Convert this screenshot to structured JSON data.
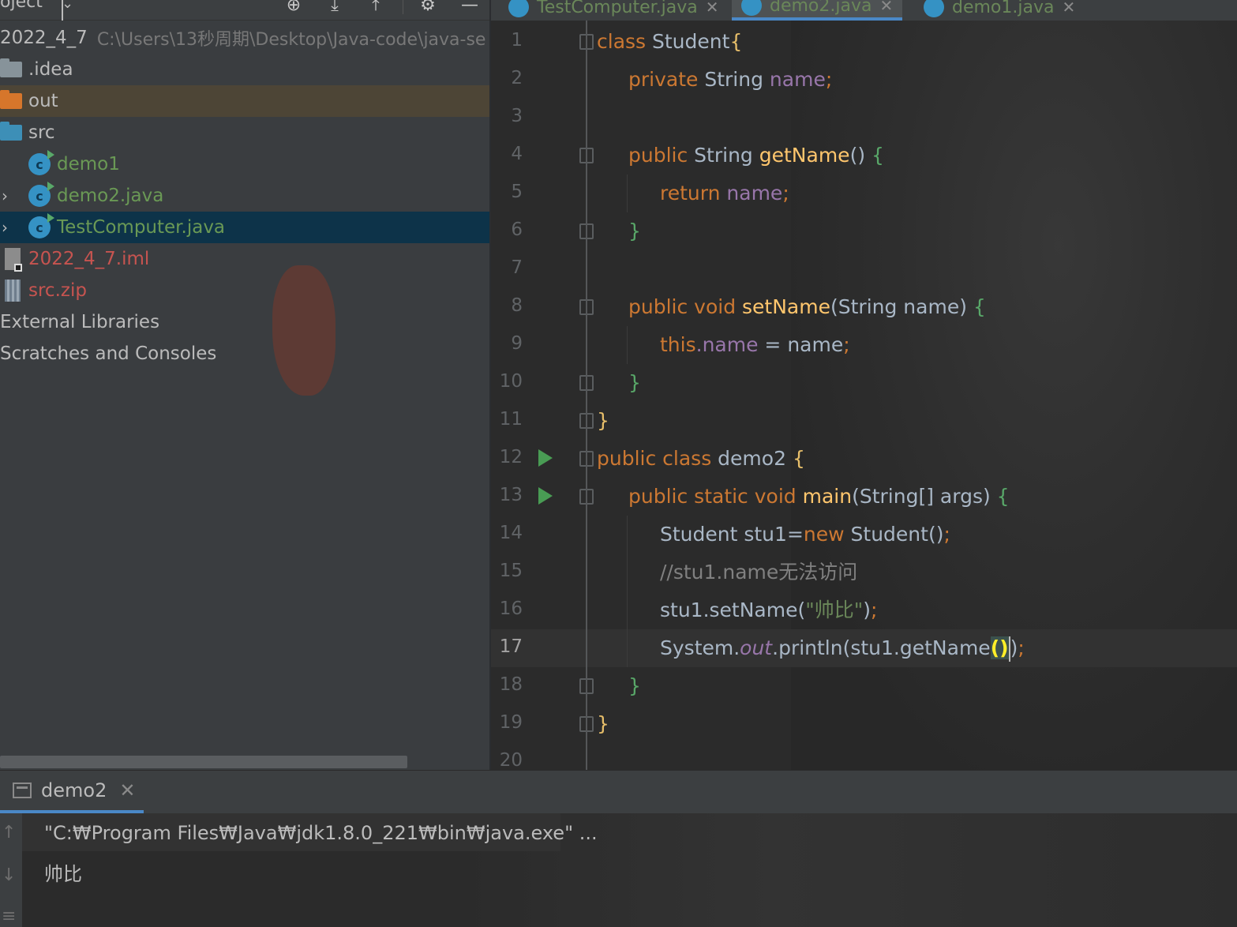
{
  "project": {
    "title_partial": "oject",
    "root_name": "2022_4_7",
    "root_path": "C:\\Users\\13秒周期\\Desktop\\Java-code\\java-se",
    "tree": [
      {
        "label": ".idea",
        "kind": "folder",
        "color": "#87939a"
      },
      {
        "label": "out",
        "kind": "folder",
        "color": "#d6762b"
      },
      {
        "label": "src",
        "kind": "folder",
        "color": "#3d8fb7"
      },
      {
        "label": "demo1",
        "kind": "class"
      },
      {
        "label": "demo2.java",
        "kind": "class"
      },
      {
        "label": "TestComputer.java",
        "kind": "class"
      },
      {
        "label": "2022_4_7.iml",
        "kind": "file"
      },
      {
        "label": "src.zip",
        "kind": "zip"
      },
      {
        "label": "External Libraries",
        "kind": "text"
      },
      {
        "label": "Scratches and Consoles",
        "kind": "text"
      }
    ]
  },
  "tabs": [
    {
      "label": "TestComputer.java"
    },
    {
      "label": "demo2.java"
    },
    {
      "label": "demo1.java"
    }
  ],
  "editor": {
    "line_numbers": [
      "1",
      "2",
      "3",
      "4",
      "5",
      "6",
      "7",
      "8",
      "9",
      "10",
      "11",
      "12",
      "13",
      "14",
      "15",
      "16",
      "17",
      "18",
      "19",
      "20"
    ],
    "current_line": "17"
  },
  "code": {
    "l1": {
      "kw": "class",
      "name": " Student",
      "brace": "{"
    },
    "l2": {
      "kw": "private",
      "type": " String ",
      "field": "name",
      "semi": ";"
    },
    "l4": {
      "kw": "public",
      "type": " String ",
      "fn": "getName",
      "rest": "() ",
      "brace": "{"
    },
    "l5": {
      "kw": "return",
      "field": " name",
      "semi": ";"
    },
    "l6": {
      "brace": "}"
    },
    "l8": {
      "kw": "public void",
      "fn": " setName",
      "rest": "(String name) ",
      "brace": "{"
    },
    "l9": {
      "kw": "this",
      "field": ".name",
      "rest": " = name",
      "semi": ";"
    },
    "l10": {
      "brace": "}"
    },
    "l11": {
      "brace": "}"
    },
    "l12": {
      "kw": "public class",
      "name": " demo2 ",
      "brace": "{"
    },
    "l13": {
      "kw": "public static void",
      "fn": " main",
      "rest": "(String[] args) ",
      "brace": "{"
    },
    "l14": {
      "a": "Student stu1=",
      "kw": "new",
      "b": " Student()",
      "semi": ";"
    },
    "l15": {
      "comment": "//stu1.name无法访问"
    },
    "l16": {
      "a": "stu1.setName(",
      "str": "\"帅比\"",
      "b": ")",
      "semi": ";"
    },
    "l17": {
      "a": "System.",
      "sfield": "out",
      "b": ".println(stu1.getName",
      "paren1": "(",
      "paren2": ")",
      "c": ")",
      "semi": ";"
    },
    "l18": {
      "brace": "}"
    },
    "l19": {
      "brace": "}"
    }
  },
  "run": {
    "tab_label": "demo2",
    "command": "\"C:₩Program Files₩Java₩jdk1.8.0_221₩bin₩java.exe\" ...",
    "output": "帅比"
  },
  "colors": {
    "keyword": "#cc7832",
    "function": "#ffc66d",
    "field": "#9876aa",
    "string": "#6a8759",
    "comment": "#808080",
    "selection": "#0d3349",
    "accent": "#4a88c7"
  }
}
